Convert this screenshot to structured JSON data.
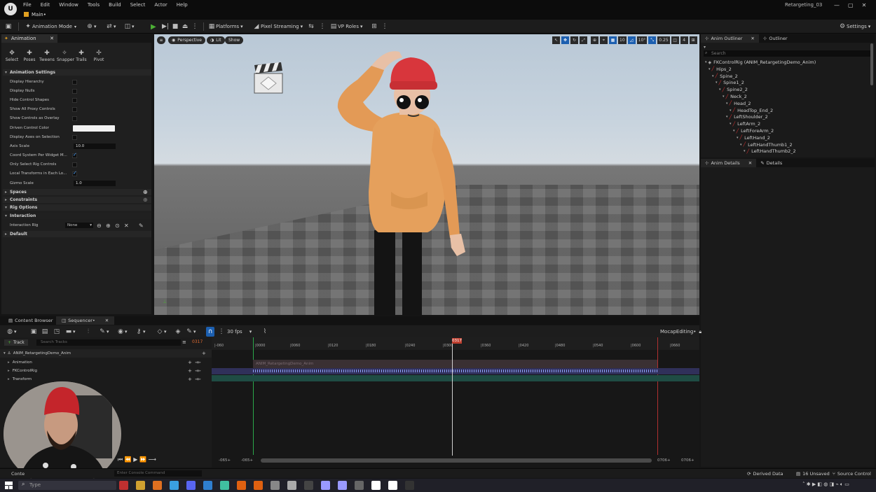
{
  "menu": [
    "File",
    "Edit",
    "Window",
    "Tools",
    "Build",
    "Select",
    "Actor",
    "Help"
  ],
  "map_tab": "Main•",
  "window_title": "Retargeting_03",
  "window_controls": [
    "—",
    "▢",
    "✕"
  ],
  "toolbar": {
    "mode": "Animation Mode",
    "platforms": "Platforms",
    "pixel_streaming": "Pixel Streaming",
    "vp_roles": "VP Roles",
    "settings": "Settings"
  },
  "anim_panel": {
    "tab": "Animation",
    "tools": [
      "Select",
      "Poses",
      "Tweens",
      "Snapper",
      "Trails",
      "Pivot"
    ],
    "sections": {
      "settings": "Animation Settings",
      "spaces": "Spaces",
      "constraints": "Constraints",
      "rig_options": "Rig Options",
      "interaction": "Interaction",
      "default": "Default"
    },
    "props": {
      "display_hierarchy": "Display Hierarchy",
      "display_nulls": "Display Nulls",
      "hide_control_shapes": "Hide Control Shapes",
      "show_proxy": "Show All Proxy Controls",
      "show_overlay": "Show Controls as Overlay",
      "driven_color": "Driven Control Color",
      "display_axes": "Display Axes on Selection",
      "axis_scale": "Axis Scale",
      "axis_scale_value": "10.0",
      "coord_system": "Coord System Per Widget M...",
      "only_select": "Only Select Rig Controls",
      "local_transforms": "Local Transforms in Each Lo...",
      "gizmo_scale": "Gizmo Scale",
      "gizmo_scale_value": "1.0",
      "interaction_rig": "Interaction Rig",
      "interaction_rig_value": "None"
    }
  },
  "viewport": {
    "perspective": "Perspective",
    "lit": "Lit",
    "show": "Show",
    "grid_snap": "10",
    "rot_snap": "10°",
    "scale_snap": "0.25",
    "camera_speed": "4"
  },
  "outliner": {
    "tabs": [
      "Anim Outliner",
      "Outliner"
    ],
    "search_placeholder": "Search",
    "nodes": [
      {
        "label": "FKControlRig  (ANIM_RetargetingDemo_Anim)",
        "depth": 0
      },
      {
        "label": "Hips_2",
        "depth": 1
      },
      {
        "label": "Spine_2",
        "depth": 2
      },
      {
        "label": "Spine1_2",
        "depth": 3
      },
      {
        "label": "Spine2_2",
        "depth": 4
      },
      {
        "label": "Neck_2",
        "depth": 5
      },
      {
        "label": "Head_2",
        "depth": 6
      },
      {
        "label": "HeadTop_End_2",
        "depth": 7
      },
      {
        "label": "LeftShoulder_2",
        "depth": 6
      },
      {
        "label": "LeftArm_2",
        "depth": 7
      },
      {
        "label": "LeftForeArm_2",
        "depth": 8
      },
      {
        "label": "LeftHand_2",
        "depth": 9
      },
      {
        "label": "LeftHandThumb1_2",
        "depth": 10
      },
      {
        "label": "LeftHandThumb2_2",
        "depth": 11
      }
    ]
  },
  "details_tabs": [
    "Anim Details",
    "Details"
  ],
  "sequencer": {
    "tabs": [
      "Content Browser",
      "Sequencer•"
    ],
    "fps": "30 fps",
    "sequence_name": "MocapEditing•",
    "track_button": "Track",
    "search_placeholder": "Search Tracks",
    "current_frame": "0317",
    "playhead": "0317",
    "ticks": [
      "-060",
      "0000",
      "0060",
      "0120",
      "0180",
      "0240",
      "0300",
      "0360",
      "0420",
      "0480",
      "0540",
      "0600",
      "0660"
    ],
    "tracks": [
      "ANIM_RetargetingDemo_Anim",
      "Animation",
      "FKControlRig",
      "Transform"
    ],
    "anim_section_label": "ANIM_RetargetingDemo_Anim",
    "range_left_a": "-065+",
    "range_left_b": "-065+",
    "range_right_a": "0706+",
    "range_right_b": "0706+"
  },
  "status": {
    "content_drawer": "Conte",
    "console_placeholder": "Enter Console Command",
    "derived_data": "Derived Data",
    "unsaved": "16 Unsaved",
    "source_control": "Source Control"
  },
  "taskbar": {
    "search": "Type",
    "apps": [
      "#c03030",
      "#d0a030",
      "#e07020",
      "#3aa0e0",
      "#5865f2",
      "#2f7fd0",
      "#40c0a0",
      "#e06010",
      "#e06010",
      "#888",
      "#aaa",
      "#444",
      "#9999ff",
      "#9999ff",
      "#666",
      "#fff",
      "#fff",
      "#333"
    ]
  },
  "colors": {
    "accent_blue": "#1c5fb0",
    "playhead": "#c04030",
    "range_start": "#2aa84a",
    "range_end": "#b03030"
  }
}
